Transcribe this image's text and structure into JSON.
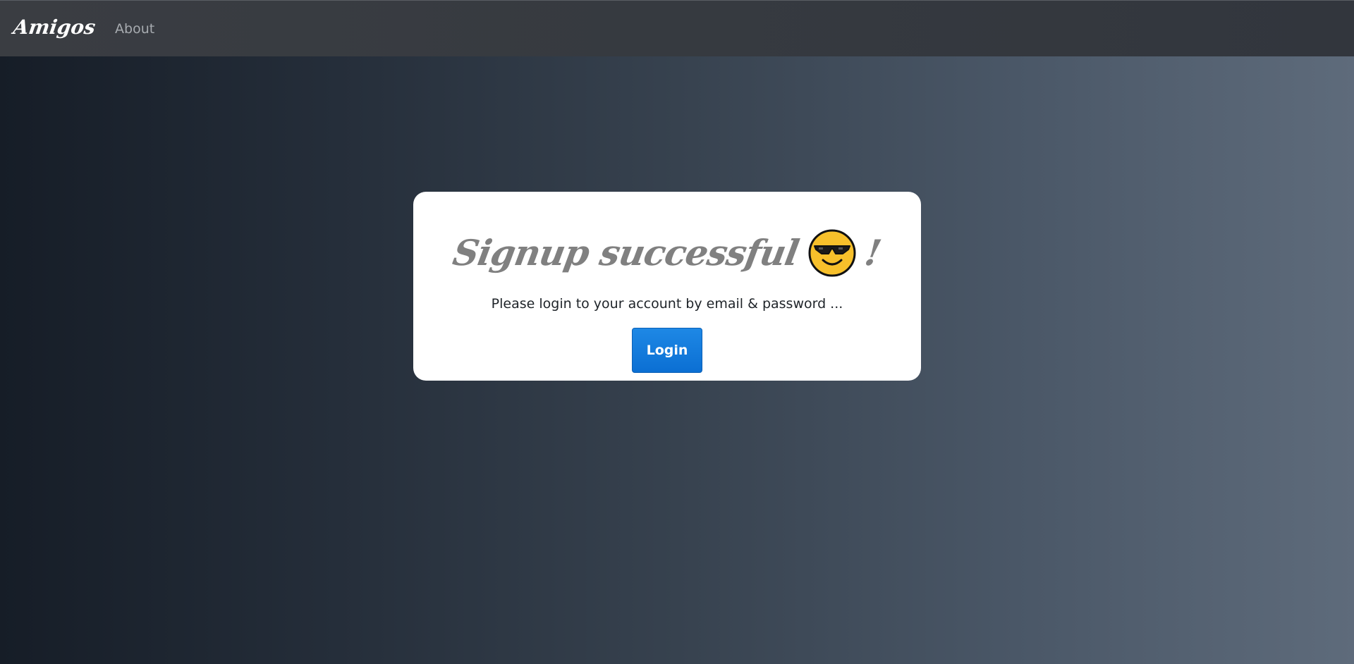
{
  "navbar": {
    "brand": "Amigos",
    "links": [
      {
        "label": "About"
      }
    ]
  },
  "card": {
    "title": "Signup successful",
    "title_suffix": "!",
    "emoji_icon": "smiling-face-with-sunglasses-icon",
    "subtitle": "Please login to your account by email & password ...",
    "login_label": "Login"
  },
  "colors": {
    "navbar_bg": "#36393f",
    "page_bg_left": "#161d27",
    "page_bg_right": "#5e6b7b",
    "card_bg": "#ffffff",
    "title_text": "#808080",
    "button_bg": "#1479dc",
    "button_text": "#ffffff"
  }
}
